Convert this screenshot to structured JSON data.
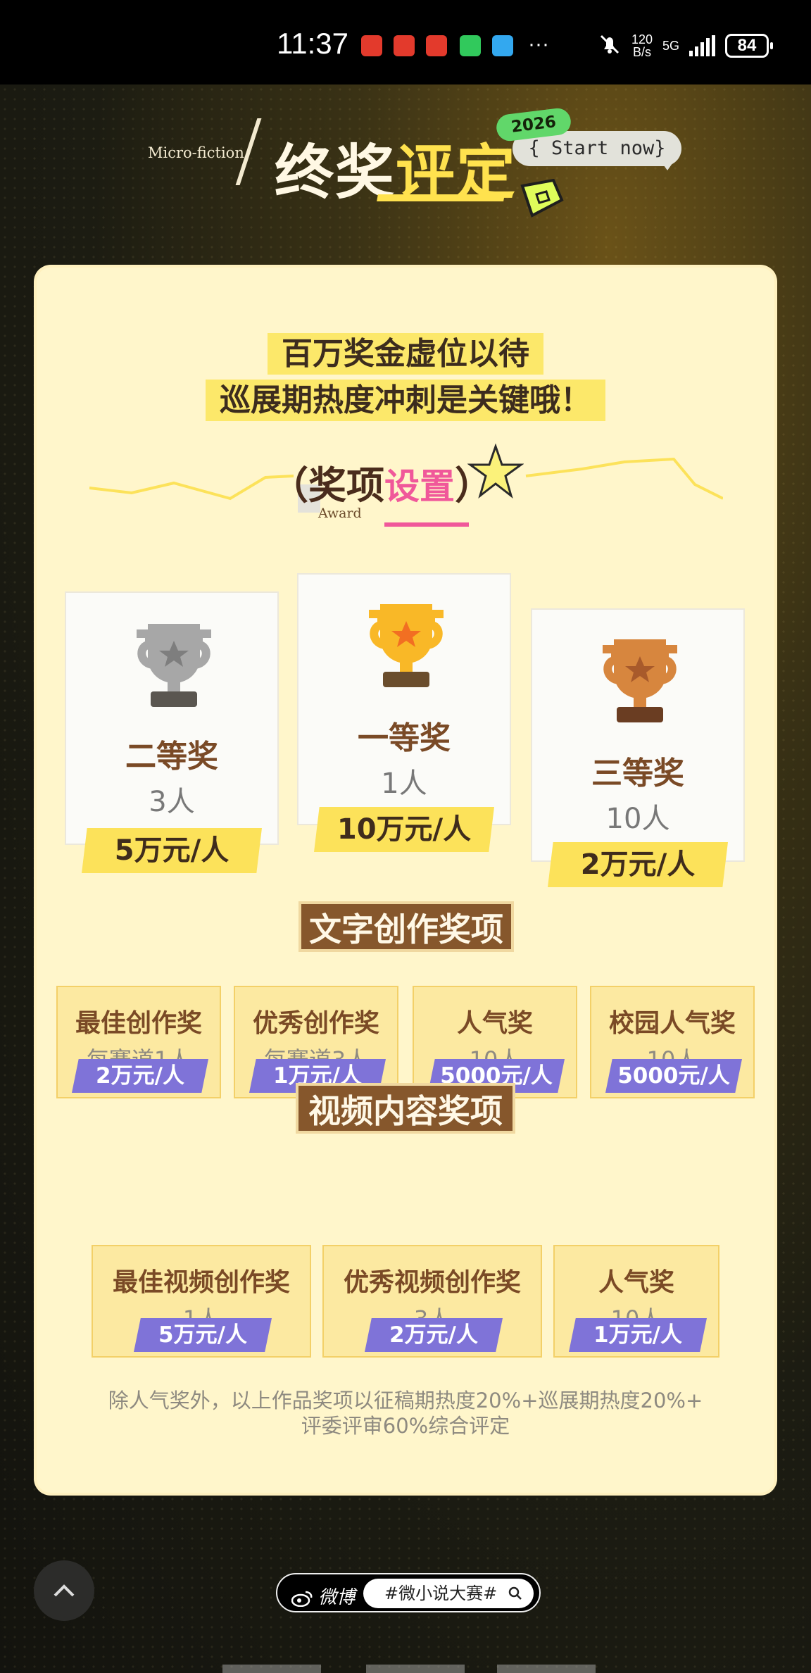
{
  "status_bar": {
    "time": "11:37",
    "network_speed": "120\nB/s",
    "network_type": "5G",
    "battery": "84"
  },
  "header": {
    "title_en": "Micro-fiction",
    "title_zh_part1": "终奖",
    "title_zh_part2": "评定",
    "year": "2026",
    "start_now": "{ Start now}"
  },
  "tagline": {
    "line1": "百万奖金虚位以待",
    "line2": "巡展期热度冲刺是关键哦！"
  },
  "award_section": {
    "title_part1": "（奖项",
    "title_part2": "设置",
    "title_part3": "）",
    "subtitle": "Award"
  },
  "top_prizes": [
    {
      "name": "二等奖",
      "count": "3人",
      "amount": "5万元/人",
      "trophy": "silver-trophy-icon",
      "color": "#a7a7a7"
    },
    {
      "name": "一等奖",
      "count": "1人",
      "amount": "10万元/人",
      "trophy": "gold-trophy-icon",
      "color": "#f9b827"
    },
    {
      "name": "三等奖",
      "count": "10人",
      "amount": "2万元/人",
      "trophy": "bronze-trophy-icon",
      "color": "#d7863e"
    }
  ],
  "text_section": {
    "title": "文字创作奖项",
    "items": [
      {
        "name": "最佳创作奖",
        "count": "每赛道1人",
        "amount": "2万元/人"
      },
      {
        "name": "优秀创作奖",
        "count": "每赛道3人",
        "amount": "1万元/人"
      },
      {
        "name": "人气奖",
        "count": "10人",
        "amount": "5000元/人"
      },
      {
        "name": "校园人气奖",
        "count": "10人",
        "amount": "5000元/人"
      }
    ]
  },
  "video_section": {
    "title": "视频内容奖项",
    "items": [
      {
        "name": "最佳视频创作奖",
        "count": "1人",
        "amount": "5万元/人"
      },
      {
        "name": "优秀视频创作奖",
        "count": "3人",
        "amount": "2万元/人"
      },
      {
        "name": "人气奖",
        "count": "10人",
        "amount": "1万元/人"
      }
    ]
  },
  "footnote": {
    "line1": "除人气奖外，以上作品奖项以征稿期热度20%+巡展期热度20%+",
    "line2": "评委评审60%综合评定"
  },
  "footer": {
    "weibo_label": "微博",
    "hashtag": "#微小说大赛#"
  },
  "colors": {
    "accent_yellow": "#fce25a",
    "brown": "#86572c",
    "purple": "#7f73d8",
    "card_bg": "#fff6cb"
  }
}
